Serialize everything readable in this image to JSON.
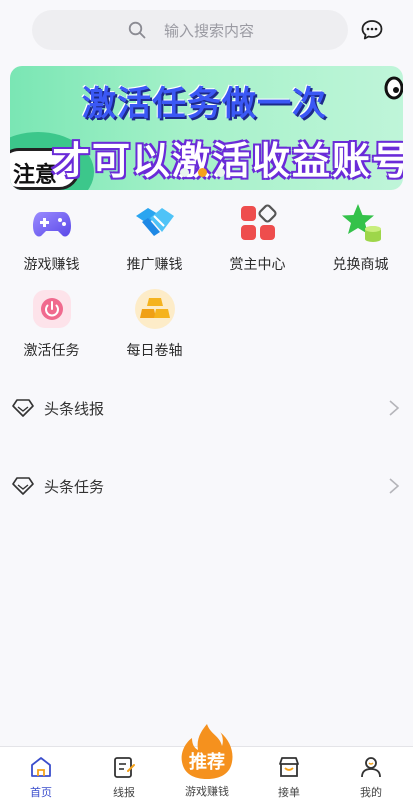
{
  "search": {
    "placeholder": "输入搜索内容",
    "icon": "search-icon"
  },
  "header": {
    "message_icon": "chat-bubble-icon"
  },
  "banner": {
    "badge_text": "注意",
    "line1": "激活任务做一次",
    "line2": "才可以激活收益账号",
    "dots": 3,
    "active_dot": 1
  },
  "grid": [
    {
      "label": "游戏赚钱",
      "icon": "gamepad-icon"
    },
    {
      "label": "推广赚钱",
      "icon": "handshake-icon"
    },
    {
      "label": "赏主中心",
      "icon": "apps-grid-icon"
    },
    {
      "label": "兑换商城",
      "icon": "star-coins-icon"
    },
    {
      "label": "激活任务",
      "icon": "power-icon"
    },
    {
      "label": "每日卷轴",
      "icon": "gold-bars-icon"
    }
  ],
  "list": [
    {
      "label": "头条线报",
      "icon": "diamond-icon"
    },
    {
      "label": "头条任务",
      "icon": "diamond-icon"
    }
  ],
  "tabbar": {
    "tabs": [
      {
        "label": "首页",
        "icon": "home-icon",
        "active": true
      },
      {
        "label": "线报",
        "icon": "note-edit-icon",
        "active": false
      },
      {
        "label": "游戏赚钱",
        "icon": "fire-icon",
        "badge": "推荐",
        "active": false
      },
      {
        "label": "接单",
        "icon": "store-icon",
        "active": false
      },
      {
        "label": "我的",
        "icon": "user-icon",
        "active": false
      }
    ]
  },
  "colors": {
    "accent": "#3b4ecc",
    "banner_blue": "#3b58f5",
    "fire": "#f5911e",
    "dot_active": "#f5a21b"
  }
}
